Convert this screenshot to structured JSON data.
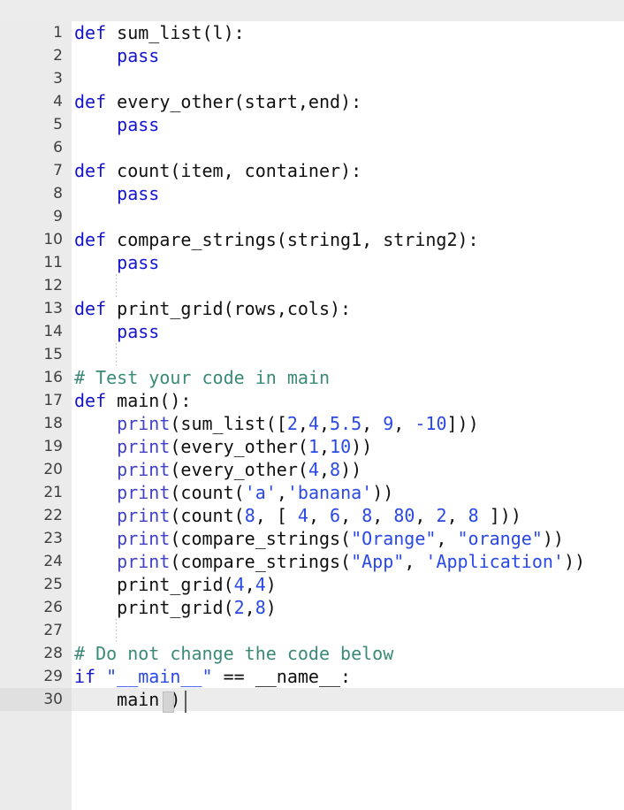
{
  "window": {
    "title": "",
    "toolbar_color": "#ececec",
    "gutter_color": "#ebebeb",
    "background_color": "#ffffff",
    "active_line_color": "#ececec",
    "active_line_number": 30
  },
  "theme": {
    "keyword_color": "#1414d0",
    "comment_color": "#3a8a78",
    "string_color": "#2a48e8",
    "number_color": "#2a48e8",
    "builtin_color": "#4040c8",
    "plain_color": "#101010",
    "line_number_color": "#404040"
  },
  "editor": {
    "language": "Python",
    "caret_line": 30,
    "caret_column": 11,
    "lines": [
      {
        "no": "1",
        "indent_guides": [],
        "tokens": [
          {
            "t": "def",
            "c": "kw"
          },
          {
            "t": " ",
            "c": "plain"
          },
          {
            "t": "sum_list(l):",
            "c": "plain"
          }
        ]
      },
      {
        "no": "2",
        "indent_guides": [],
        "tokens": [
          {
            "t": "    ",
            "c": "plain"
          },
          {
            "t": "pass",
            "c": "kw"
          }
        ]
      },
      {
        "no": "3",
        "indent_guides": [],
        "tokens": []
      },
      {
        "no": "4",
        "indent_guides": [],
        "tokens": [
          {
            "t": "def",
            "c": "kw"
          },
          {
            "t": " ",
            "c": "plain"
          },
          {
            "t": "every_other(start,end):",
            "c": "plain"
          }
        ]
      },
      {
        "no": "5",
        "indent_guides": [],
        "tokens": [
          {
            "t": "    ",
            "c": "plain"
          },
          {
            "t": "pass",
            "c": "kw"
          }
        ]
      },
      {
        "no": "6",
        "indent_guides": [],
        "tokens": []
      },
      {
        "no": "7",
        "indent_guides": [],
        "tokens": [
          {
            "t": "def",
            "c": "kw"
          },
          {
            "t": " ",
            "c": "plain"
          },
          {
            "t": "count(item, container):",
            "c": "plain"
          }
        ]
      },
      {
        "no": "8",
        "indent_guides": [],
        "tokens": [
          {
            "t": "    ",
            "c": "plain"
          },
          {
            "t": "pass",
            "c": "kw"
          }
        ]
      },
      {
        "no": "9",
        "indent_guides": [],
        "tokens": []
      },
      {
        "no": "10",
        "indent_guides": [],
        "tokens": [
          {
            "t": "def",
            "c": "kw"
          },
          {
            "t": " ",
            "c": "plain"
          },
          {
            "t": "compare_strings(string1, string2):",
            "c": "plain"
          }
        ]
      },
      {
        "no": "11",
        "indent_guides": [],
        "tokens": [
          {
            "t": "    ",
            "c": "plain"
          },
          {
            "t": "pass",
            "c": "kw"
          }
        ]
      },
      {
        "no": "12",
        "indent_guides": [
          47
        ],
        "tokens": []
      },
      {
        "no": "13",
        "indent_guides": [],
        "tokens": [
          {
            "t": "def",
            "c": "kw"
          },
          {
            "t": " ",
            "c": "plain"
          },
          {
            "t": "print_grid(rows,cols):",
            "c": "plain"
          }
        ]
      },
      {
        "no": "14",
        "indent_guides": [],
        "tokens": [
          {
            "t": "    ",
            "c": "plain"
          },
          {
            "t": "pass",
            "c": "kw"
          }
        ]
      },
      {
        "no": "15",
        "indent_guides": [
          47
        ],
        "tokens": []
      },
      {
        "no": "16",
        "indent_guides": [],
        "tokens": [
          {
            "t": "# Test your code in main",
            "c": "com"
          }
        ]
      },
      {
        "no": "17",
        "indent_guides": [],
        "tokens": [
          {
            "t": "def",
            "c": "kw"
          },
          {
            "t": " ",
            "c": "plain"
          },
          {
            "t": "main():",
            "c": "plain"
          }
        ]
      },
      {
        "no": "18",
        "indent_guides": [],
        "tokens": [
          {
            "t": "    ",
            "c": "plain"
          },
          {
            "t": "print",
            "c": "builtin"
          },
          {
            "t": "(sum_list([",
            "c": "plain"
          },
          {
            "t": "2",
            "c": "num"
          },
          {
            "t": ",",
            "c": "plain"
          },
          {
            "t": "4",
            "c": "num"
          },
          {
            "t": ",",
            "c": "plain"
          },
          {
            "t": "5.5",
            "c": "num"
          },
          {
            "t": ", ",
            "c": "plain"
          },
          {
            "t": "9",
            "c": "num"
          },
          {
            "t": ", ",
            "c": "plain"
          },
          {
            "t": "-10",
            "c": "num"
          },
          {
            "t": "]))",
            "c": "plain"
          }
        ]
      },
      {
        "no": "19",
        "indent_guides": [],
        "tokens": [
          {
            "t": "    ",
            "c": "plain"
          },
          {
            "t": "print",
            "c": "builtin"
          },
          {
            "t": "(every_other(",
            "c": "plain"
          },
          {
            "t": "1",
            "c": "num"
          },
          {
            "t": ",",
            "c": "plain"
          },
          {
            "t": "10",
            "c": "num"
          },
          {
            "t": "))",
            "c": "plain"
          }
        ]
      },
      {
        "no": "20",
        "indent_guides": [],
        "tokens": [
          {
            "t": "    ",
            "c": "plain"
          },
          {
            "t": "print",
            "c": "builtin"
          },
          {
            "t": "(every_other(",
            "c": "plain"
          },
          {
            "t": "4",
            "c": "num"
          },
          {
            "t": ",",
            "c": "plain"
          },
          {
            "t": "8",
            "c": "num"
          },
          {
            "t": "))",
            "c": "plain"
          }
        ]
      },
      {
        "no": "21",
        "indent_guides": [],
        "tokens": [
          {
            "t": "    ",
            "c": "plain"
          },
          {
            "t": "print",
            "c": "builtin"
          },
          {
            "t": "(count(",
            "c": "plain"
          },
          {
            "t": "'a'",
            "c": "str"
          },
          {
            "t": ",",
            "c": "plain"
          },
          {
            "t": "'banana'",
            "c": "str"
          },
          {
            "t": "))",
            "c": "plain"
          }
        ]
      },
      {
        "no": "22",
        "indent_guides": [],
        "tokens": [
          {
            "t": "    ",
            "c": "plain"
          },
          {
            "t": "print",
            "c": "builtin"
          },
          {
            "t": "(count(",
            "c": "plain"
          },
          {
            "t": "8",
            "c": "num"
          },
          {
            "t": ", [ ",
            "c": "plain"
          },
          {
            "t": "4",
            "c": "num"
          },
          {
            "t": ", ",
            "c": "plain"
          },
          {
            "t": "6",
            "c": "num"
          },
          {
            "t": ", ",
            "c": "plain"
          },
          {
            "t": "8",
            "c": "num"
          },
          {
            "t": ", ",
            "c": "plain"
          },
          {
            "t": "80",
            "c": "num"
          },
          {
            "t": ", ",
            "c": "plain"
          },
          {
            "t": "2",
            "c": "num"
          },
          {
            "t": ", ",
            "c": "plain"
          },
          {
            "t": "8",
            "c": "num"
          },
          {
            "t": " ]))",
            "c": "plain"
          }
        ]
      },
      {
        "no": "23",
        "indent_guides": [],
        "tokens": [
          {
            "t": "    ",
            "c": "plain"
          },
          {
            "t": "print",
            "c": "builtin"
          },
          {
            "t": "(compare_strings(",
            "c": "plain"
          },
          {
            "t": "\"Orange\"",
            "c": "str"
          },
          {
            "t": ", ",
            "c": "plain"
          },
          {
            "t": "\"orange\"",
            "c": "str"
          },
          {
            "t": "))",
            "c": "plain"
          }
        ]
      },
      {
        "no": "24",
        "indent_guides": [],
        "tokens": [
          {
            "t": "    ",
            "c": "plain"
          },
          {
            "t": "print",
            "c": "builtin"
          },
          {
            "t": "(compare_strings(",
            "c": "plain"
          },
          {
            "t": "\"App\"",
            "c": "str"
          },
          {
            "t": ", ",
            "c": "plain"
          },
          {
            "t": "'Application'",
            "c": "str"
          },
          {
            "t": "))",
            "c": "plain"
          }
        ]
      },
      {
        "no": "25",
        "indent_guides": [],
        "tokens": [
          {
            "t": "    print_grid(",
            "c": "plain"
          },
          {
            "t": "4",
            "c": "num"
          },
          {
            "t": ",",
            "c": "plain"
          },
          {
            "t": "4",
            "c": "num"
          },
          {
            "t": ")",
            "c": "plain"
          }
        ]
      },
      {
        "no": "26",
        "indent_guides": [],
        "tokens": [
          {
            "t": "    print_grid(",
            "c": "plain"
          },
          {
            "t": "2",
            "c": "num"
          },
          {
            "t": ",",
            "c": "plain"
          },
          {
            "t": "8",
            "c": "num"
          },
          {
            "t": ")",
            "c": "plain"
          }
        ]
      },
      {
        "no": "27",
        "indent_guides": [
          47
        ],
        "tokens": []
      },
      {
        "no": "28",
        "indent_guides": [],
        "tokens": [
          {
            "t": "# Do not change the code below",
            "c": "com"
          }
        ]
      },
      {
        "no": "29",
        "indent_guides": [],
        "tokens": [
          {
            "t": "if",
            "c": "kw"
          },
          {
            "t": " ",
            "c": "plain"
          },
          {
            "t": "\"__main__\"",
            "c": "str"
          },
          {
            "t": " == __name__:",
            "c": "plain"
          }
        ]
      },
      {
        "no": "30",
        "indent_guides": [],
        "tokens": [
          {
            "t": "    main()",
            "c": "plain"
          }
        ]
      }
    ]
  }
}
